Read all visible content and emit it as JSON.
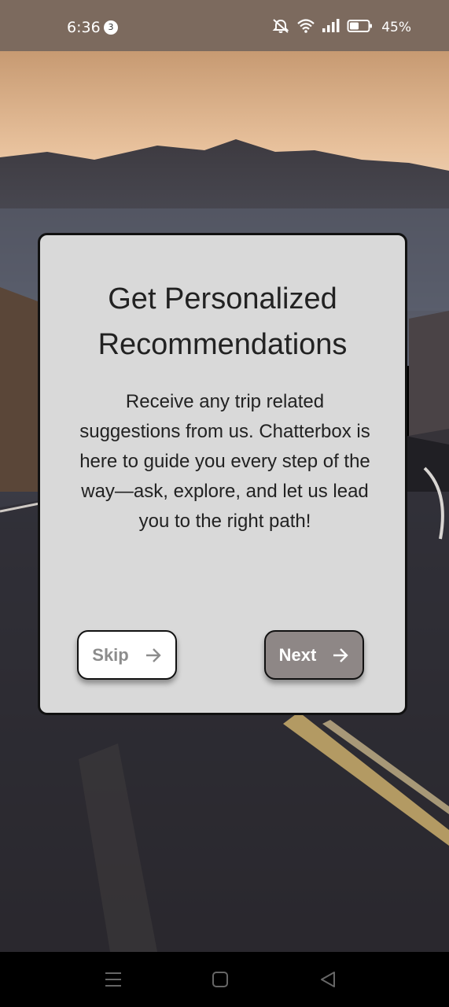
{
  "status_bar": {
    "time": "6:36",
    "notification_count": "3",
    "battery_percent": "45%"
  },
  "card": {
    "title": "Get Personalized Recommendations",
    "body": "Receive any trip related suggestions from us. Chatterbox is here to guide you every step of the way—ask, explore, and let us lead you to the right path!",
    "skip_label": "Skip",
    "next_label": "Next"
  },
  "colors": {
    "card_bg": "#d9d9d9",
    "next_button_bg": "#8e8786",
    "skip_button_bg": "#ffffff",
    "status_bar_bg": "#7c6a5e"
  },
  "icons": {
    "status": [
      "mute-icon",
      "wifi-icon",
      "signal-icon",
      "battery-icon"
    ],
    "buttons": [
      "arrow-right-icon"
    ],
    "nav": [
      "menu-icon",
      "home-icon",
      "back-icon"
    ]
  }
}
